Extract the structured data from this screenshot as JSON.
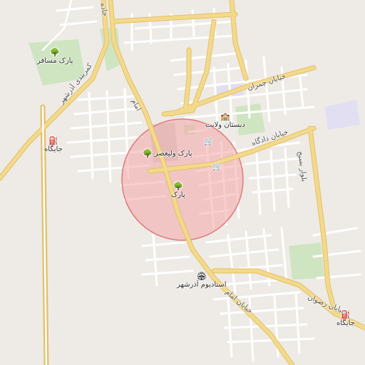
{
  "map": {
    "labels": {
      "park_mosafer": "پارک مسافر",
      "ring_road": "کمربندی آذرشهر",
      "imam_north": "امام",
      "jadeh": "جاده",
      "station_west": "جایگاه",
      "khiyaban_chamran": "خیابان چمران",
      "dabestan_velayat": "دبستان ولایت",
      "park_valiasr": "پارک ولیعصر",
      "khiyaban_dadgah": "خیابان دادگاه",
      "blvd_basij": "بلوار بسیج",
      "park_center": "پارک",
      "stadium": "استادیوم آذرشهر",
      "khiyaban_imam": "خیابان امام",
      "khiyaban_rezvan": "خیابان رضوان",
      "station_east": "جایگاه"
    },
    "icons": {
      "tree": "tree-icon",
      "fuel": "fuel-icon",
      "school": "school-icon",
      "shop": "shopping-cart-icon",
      "stadium": "stadium-icon"
    },
    "colors": {
      "background": "#eeebe6",
      "major_road": "#f3d98b",
      "major_road_casing": "#e3c068",
      "minor_road": "#ffffff",
      "park": "#cfe5c2",
      "radius_fill": "#f4a6a6",
      "radius_stroke": "#e07b7b",
      "school_area": "#e2dff2"
    }
  }
}
